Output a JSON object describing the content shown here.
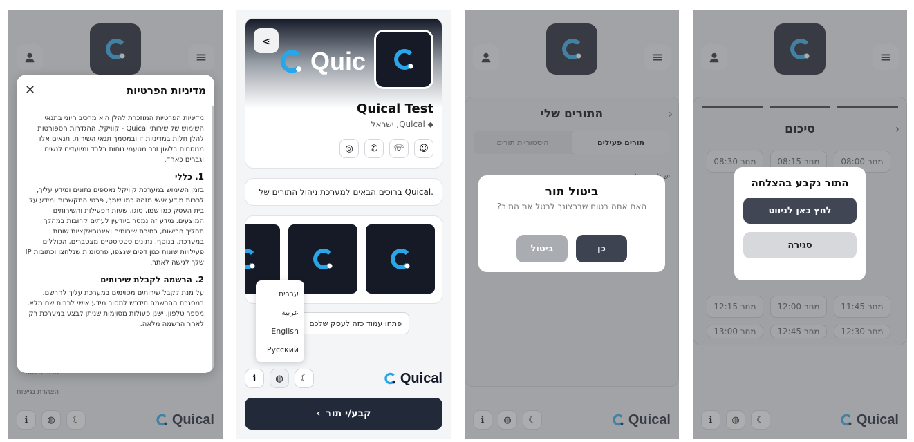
{
  "colors": {
    "dark": "#161a27",
    "accent": "#2aa6e8",
    "button_dark": "#222a3a",
    "gray_btn": "#9aa0a8"
  },
  "p1": {
    "title": "מדיניות הפרטיות",
    "intro": "מדיניות הפרטיות המוזכרת להלן היא מרכיב חיוני בתנאי השימוש של שירותי Quical - קוויקל. ההגדרות הספורטות להלן חלות במדיניות זו ובמסמך תנאי השירות. תנאים אלו מנוסחים בלשון זכר מטעמי נוחות בלבד ומיועדים לנשים וגברים כאחד.",
    "s1_title": "1. כללי",
    "s1_text": "בזמן השימוש במערכת קוויקל נאספים נתונים ומידע עליך, לרבות מידע אישי מזהה כמו שמך, פרטי התקשרות ומידע על בית העסק כמו שמו, סוגו, שעות הפעילות והשירותים המוצעים. מידע זה נמסר ביודעין לעתים קרובות במהלך תהליך הרישום, בחירת שירותים ואינטראקציות שונות במערכת. בנוסף, נתונים סטטיסטיים מצטברים, הכוללים פעילויות שונות כגון דפים שנצפו, פרסומות שנלחצו וכתובות IP שלך לגישה לאתר.",
    "s2_title": "2. הרשמה לקבלת שירותים",
    "s2_text": "על מנת לקבל שירותים מסוימים במערכת עליך להרשם. במסגרת ההרשמה תידרש למסור מידע אישי לרבות שם מלא, מספר טלפון. ישנן פעולות מסוימות שניתן לבצע במערכת רק לאחר הרשמה מלאה.",
    "under1": "תנאי שימוש",
    "under2": "הצהרת נגישות"
  },
  "brand": "Quical",
  "p2": {
    "hero_text": "Quic",
    "business_name": "Quical Test",
    "location": "Quical, ישראל",
    "welcome": "ברוכים הבאים למערכת ניהול התורים של Quical.",
    "open_page": "פתחו עמוד כזה לעסק שלכם",
    "languages": [
      "עברית",
      "عربية",
      "English",
      "Русский"
    ],
    "book_button": "קבע/י תור"
  },
  "p3": {
    "title": "ביטול תור",
    "message": "האם אתה בטוח שברצונך לבטל את התור?",
    "yes": "כן",
    "cancel": "ביטול",
    "bg_title": "התורים שלי",
    "tab_active": "תורים פעילים",
    "tab_history": "היסטוריית תורים",
    "bg_msg": "יש לך תור ל שירות בדיקה בתאריך"
  },
  "p4": {
    "title": "התור נקבע בהצלחה",
    "nav_button": "לחץ כאן לניווט",
    "close": "סגירה",
    "bg_title": "סיכום",
    "slots": [
      "08:00 מחר",
      "08:15 מחר",
      "08:30 מחר",
      "11:45 מחר",
      "12:00 מחר",
      "12:15 מחר",
      "12:30 מחר",
      "12:45 מחר",
      "13:00 מחר"
    ]
  }
}
